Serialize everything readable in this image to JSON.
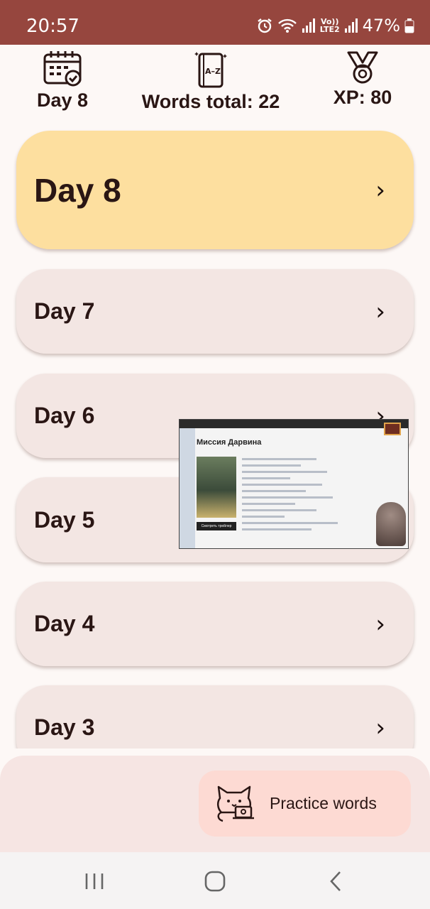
{
  "status_bar": {
    "time": "20:57",
    "network_label_top": "Vo))",
    "network_label_bottom": "LTE2",
    "battery": "47%"
  },
  "header": {
    "day_label": "Day 8",
    "words_label": "Words total: 22",
    "xp_label": "XP: 80"
  },
  "days": [
    {
      "label": "Day 8",
      "current": true
    },
    {
      "label": "Day 7",
      "current": false
    },
    {
      "label": "Day 6",
      "current": false
    },
    {
      "label": "Day 5",
      "current": false
    },
    {
      "label": "Day 4",
      "current": false
    },
    {
      "label": "Day 3",
      "current": false
    }
  ],
  "chevron_icon": "chevron-right-icon",
  "pip_overlay": {
    "title": "Миссия Дарвина",
    "trailer_label": "Смотреть трейлер"
  },
  "practice_button": {
    "label": "Practice words",
    "icon": "cat-laptop-icon"
  },
  "colors": {
    "status_bar": "#96463e",
    "current_day_card": "#fddf9f",
    "day_card": "#f3e6e3",
    "practice_button": "#fddad3",
    "background": "#fdf8f6"
  }
}
